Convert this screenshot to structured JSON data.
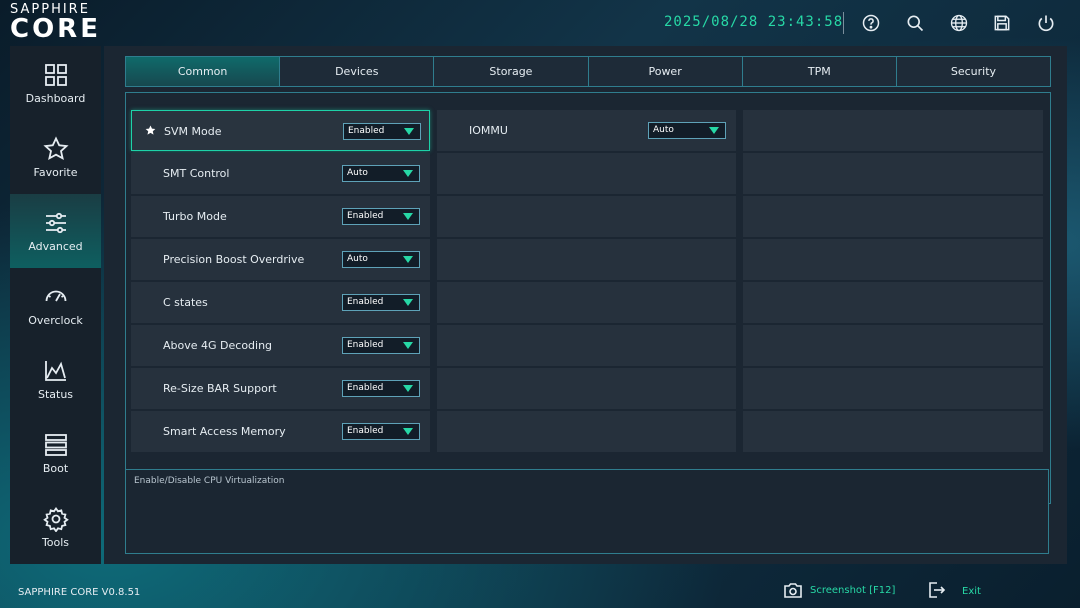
{
  "brand": {
    "top": "SAPPHIRE",
    "main": "CORE"
  },
  "datetime": "2025/08/28 23:43:58",
  "sidebar": {
    "items": [
      {
        "label": "Dashboard",
        "icon": "dashboard-icon"
      },
      {
        "label": "Favorite",
        "icon": "star-icon"
      },
      {
        "label": "Advanced",
        "icon": "sliders-icon"
      },
      {
        "label": "Overclock",
        "icon": "gauge-icon"
      },
      {
        "label": "Status",
        "icon": "chart-icon"
      },
      {
        "label": "Boot",
        "icon": "boot-icon"
      },
      {
        "label": "Tools",
        "icon": "gear-icon"
      }
    ],
    "active": "Advanced"
  },
  "tabs": [
    "Common",
    "Devices",
    "Storage",
    "Power",
    "TPM",
    "Security"
  ],
  "active_tab": "Common",
  "settings_left": [
    {
      "label": "SVM Mode",
      "value": "Enabled",
      "favorite": true
    },
    {
      "label": "SMT Control",
      "value": "Auto"
    },
    {
      "label": "Turbo Mode",
      "value": "Enabled"
    },
    {
      "label": "Precision Boost Overdrive",
      "value": "Auto"
    },
    {
      "label": "C states",
      "value": "Enabled"
    },
    {
      "label": "Above 4G Decoding",
      "value": "Enabled"
    },
    {
      "label": "Re-Size BAR Support",
      "value": "Enabled"
    },
    {
      "label": "Smart Access Memory",
      "value": "Enabled"
    }
  ],
  "settings_mid": [
    {
      "label": "IOMMU",
      "value": "Auto"
    }
  ],
  "description": "Enable/Disable CPU Virtualization",
  "footer": {
    "version": "SAPPHIRE CORE V0.8.51",
    "screenshot": "Screenshot [F12]",
    "exit": "Exit"
  },
  "colors": {
    "accent": "#27d8a6",
    "border": "#2f7d8e",
    "panel": "#1b2632",
    "row": "#26313d"
  }
}
